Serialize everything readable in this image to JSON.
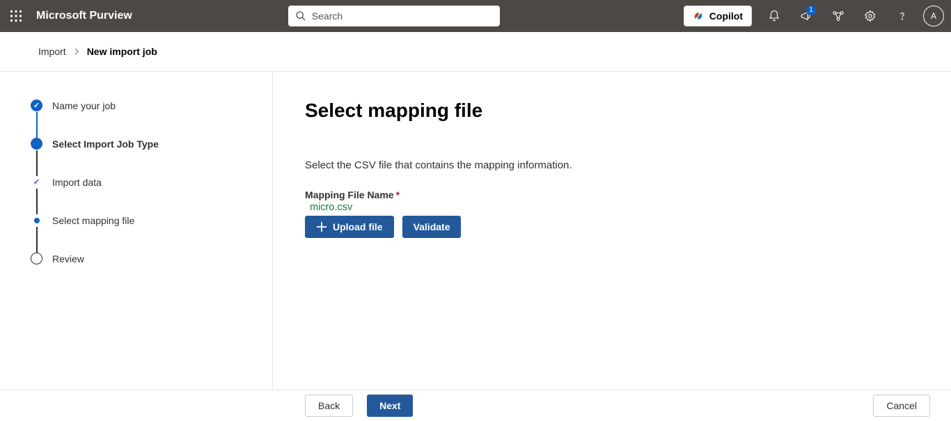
{
  "header": {
    "app_title": "Microsoft Purview",
    "search_placeholder": "Search",
    "copilot_label": "Copilot",
    "notification_badge": "1",
    "avatar_initial": "A"
  },
  "breadcrumb": {
    "parent": "Import",
    "current": "New import job"
  },
  "steps": [
    {
      "label": "Name your job"
    },
    {
      "label": "Select Import Job Type"
    },
    {
      "label": "Import data"
    },
    {
      "label": "Select mapping file"
    },
    {
      "label": "Review"
    }
  ],
  "main": {
    "title": "Select mapping file",
    "description": "Select the CSV file that contains the mapping information.",
    "field_label": "Mapping File Name",
    "required_mark": "*",
    "file_name": "micro.csv",
    "upload_label": "Upload file",
    "validate_label": "Validate"
  },
  "footer": {
    "back": "Back",
    "next": "Next",
    "cancel": "Cancel"
  }
}
